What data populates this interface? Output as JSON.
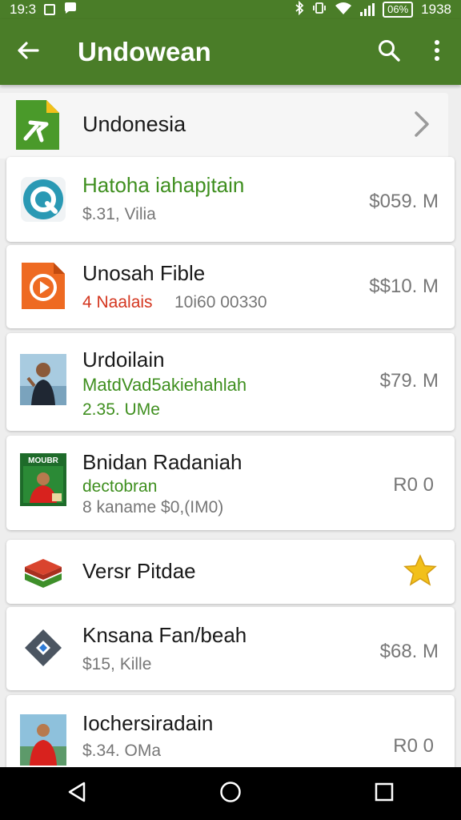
{
  "status_bar": {
    "time": "19:3",
    "battery": "06%",
    "clock": "1938"
  },
  "app_bar": {
    "title": "Undowean"
  },
  "header_row": {
    "label": "Undonesia"
  },
  "items": [
    {
      "title": "Hatoha iahapjtain",
      "line1": "$.31, Vilia",
      "price": "$059. M"
    },
    {
      "title": "Unosah Fible",
      "line1_red": "4 Naalais",
      "line1_gray": "10i60 00330",
      "price": "$$10. M"
    },
    {
      "title": "Urdoilain",
      "line1": "MatdVad5akiehahlah",
      "line2": "2.35. UMe",
      "price": "$79. M"
    },
    {
      "title": "Bnidan Radaniah",
      "line1": "dectobran",
      "line2": "8 kaname $0,(IM0)",
      "price": "R0 0",
      "icon_caption": "MOUBR"
    },
    {
      "title": "Versr Pitdae"
    },
    {
      "title": "Knsana Fan/beah",
      "line1": "$15,  Kille",
      "price": "$68. M"
    },
    {
      "title": "Iochersiradain",
      "line1": "$.34. OMa",
      "price": "R0 0"
    }
  ],
  "colors": {
    "primary": "#4a7d28",
    "accent_green": "#3f8f1f",
    "accent_red": "#d4361f",
    "star": "#f2c01a"
  },
  "icons": {
    "back": "arrow-left",
    "search": "magnifier",
    "more": "three-dots-vertical",
    "star": "star-filled"
  }
}
